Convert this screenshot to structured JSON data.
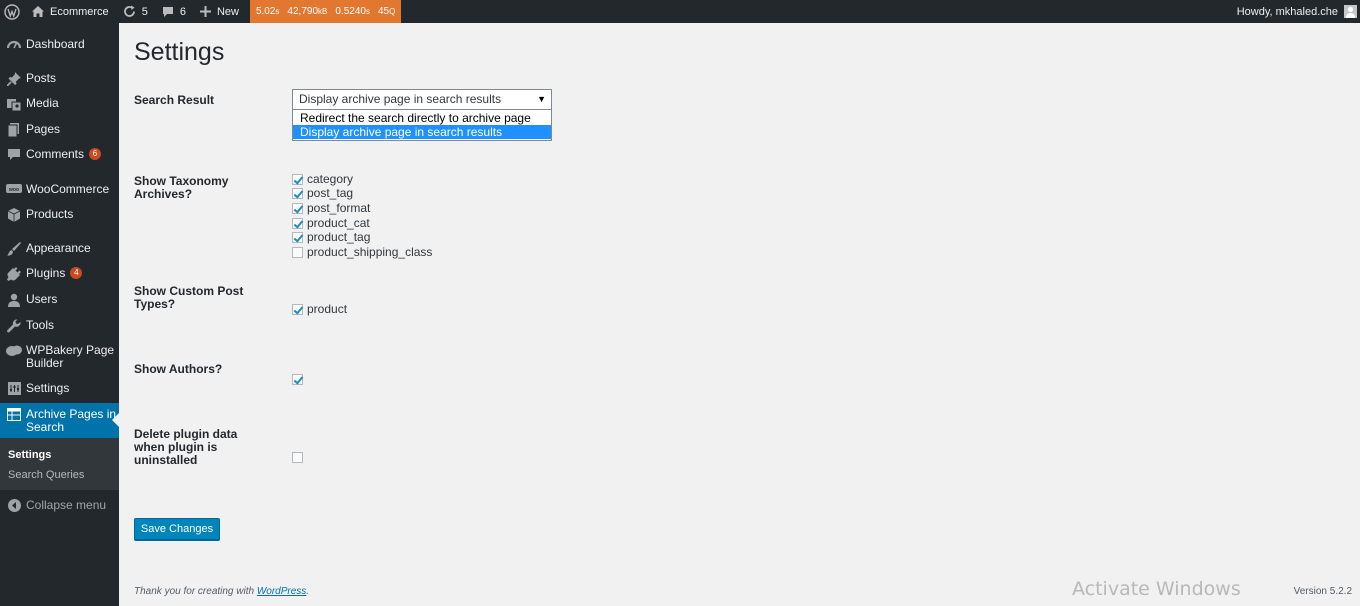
{
  "admin_bar": {
    "site_name": "Ecommerce",
    "updates_count": "5",
    "comments_count": "6",
    "new_label": "New",
    "qm": {
      "time": "5.02",
      "time_unit": "s",
      "memory": "42,790",
      "memory_unit": "kB",
      "query_time": "0.5240",
      "query_time_unit": "s",
      "queries": "45",
      "queries_unit": "Q"
    },
    "greeting": "Howdy, mkhaled.che"
  },
  "sidebar": {
    "items": [
      {
        "label": "Dashboard",
        "icon": "dashboard-icon"
      },
      {
        "label": "Posts",
        "icon": "pin-icon"
      },
      {
        "label": "Media",
        "icon": "media-icon"
      },
      {
        "label": "Pages",
        "icon": "pages-icon"
      },
      {
        "label": "Comments",
        "icon": "comment-icon",
        "badge": "6"
      },
      {
        "label": "WooCommerce",
        "icon": "woocommerce-icon"
      },
      {
        "label": "Products",
        "icon": "products-icon"
      },
      {
        "label": "Appearance",
        "icon": "brush-icon"
      },
      {
        "label": "Plugins",
        "icon": "plug-icon",
        "badge": "4"
      },
      {
        "label": "Users",
        "icon": "user-icon"
      },
      {
        "label": "Tools",
        "icon": "wrench-icon"
      },
      {
        "label": "WPBakery Page Builder",
        "icon": "wpbakery-icon"
      },
      {
        "label": "Settings",
        "icon": "settings-icon"
      },
      {
        "label": "Archive Pages in Search",
        "icon": "table-icon"
      }
    ],
    "submenu": [
      {
        "label": "Settings"
      },
      {
        "label": "Search Queries"
      }
    ],
    "collapse_label": "Collapse menu"
  },
  "page": {
    "title": "Settings",
    "search_result": {
      "label": "Search Result",
      "selected": "Display archive page in search results",
      "options": [
        "Redirect the search directly to archive page",
        "Display archive page in search results"
      ]
    },
    "taxonomy": {
      "label": "Show Taxonomy Archives?",
      "items": [
        {
          "name": "category",
          "checked": true
        },
        {
          "name": "post_tag",
          "checked": true
        },
        {
          "name": "post_format",
          "checked": true
        },
        {
          "name": "product_cat",
          "checked": true
        },
        {
          "name": "product_tag",
          "checked": true
        },
        {
          "name": "product_shipping_class",
          "checked": false
        }
      ]
    },
    "post_types": {
      "label": "Show Custom Post Types?",
      "items": [
        {
          "name": "product",
          "checked": true
        }
      ]
    },
    "authors": {
      "label": "Show Authors?",
      "checked": true
    },
    "delete_data": {
      "label": "Delete plugin data when plugin is uninstalled",
      "checked": false
    },
    "save_label": "Save Changes"
  },
  "footer": {
    "thanks_prefix": "Thank you for creating with ",
    "thanks_link": "WordPress",
    "thanks_suffix": ".",
    "version": "Version 5.2.2",
    "watermark": "Activate Windows"
  },
  "colors": {
    "admin_bar": "#23282d",
    "sidebar": "#23282d",
    "active_menu": "#0073aa",
    "qm_badge": "#e27730",
    "count_badge": "#ca4a1f",
    "primary_button": "#0085ba",
    "dropdown_highlight": "#1e90ff"
  }
}
